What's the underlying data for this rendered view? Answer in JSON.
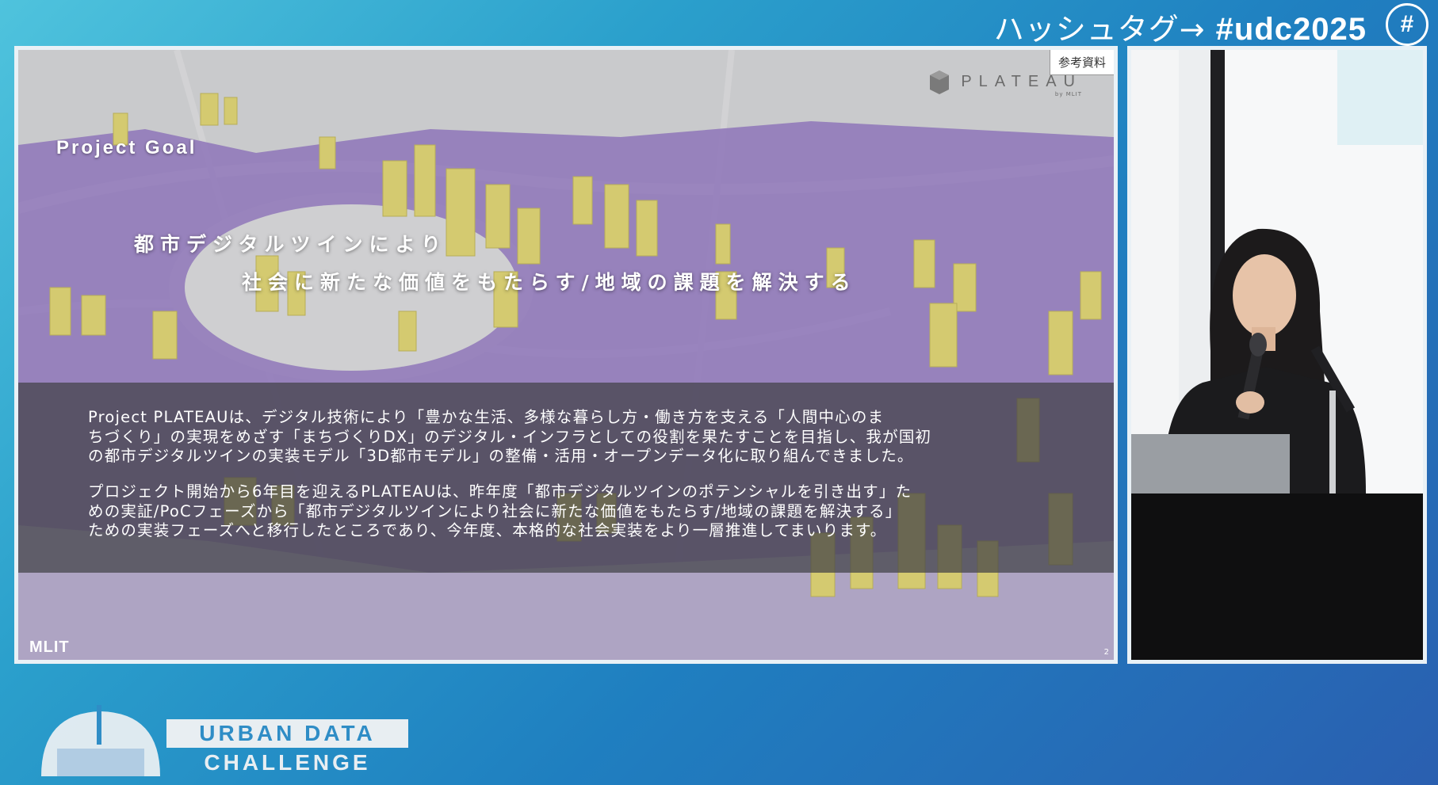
{
  "overlay": {
    "hashtag_label": "ハッシュタグ→",
    "hashtag": "#udc2025",
    "hash_symbol": "#"
  },
  "slide": {
    "reference_badge": "参考資料",
    "brand_word": "PLATEAU",
    "brand_by": "by MLIT",
    "goal_label": "Project Goal",
    "headline_1": "都市デジタルツインにより",
    "headline_2": "社会に新たな価値をもたらす/地域の課題を解決する",
    "paragraph_1": [
      "Project PLATEAUは、デジタル技術により「豊かな生活、多様な暮らし方・働き方を支える「人間中心のま",
      "ちづくり」の実現をめざす「まちづくりDX」のデジタル・インフラとしての役割を果たすことを目指し、我が国初",
      "の都市デジタルツインの実装モデル「3D都市モデル」の整備・活用・オープンデータ化に取り組んできました。"
    ],
    "paragraph_2": [
      "プロジェクト開始から6年目を迎えるPLATEAUは、昨年度「都市デジタルツインのポテンシャルを引き出す」た",
      "めの実証/PoCフェーズから「都市デジタルツインにより社会に新たな価値をもたらす/地域の課題を解決する」",
      "ための実装フェーズへと移行したところであり、今年度、本格的な社会実装をより一層推進してまいります。"
    ],
    "footer_logo": "MLIT",
    "page_number": "2"
  },
  "event_logo": {
    "line_1": "URBAN DATA",
    "line_2": "CHALLENGE"
  },
  "colors": {
    "background_start": "#4fc3dd",
    "background_end": "#2a5fb0",
    "building_purple": "#8a6bbd",
    "building_yellow": "#d2c86e"
  }
}
